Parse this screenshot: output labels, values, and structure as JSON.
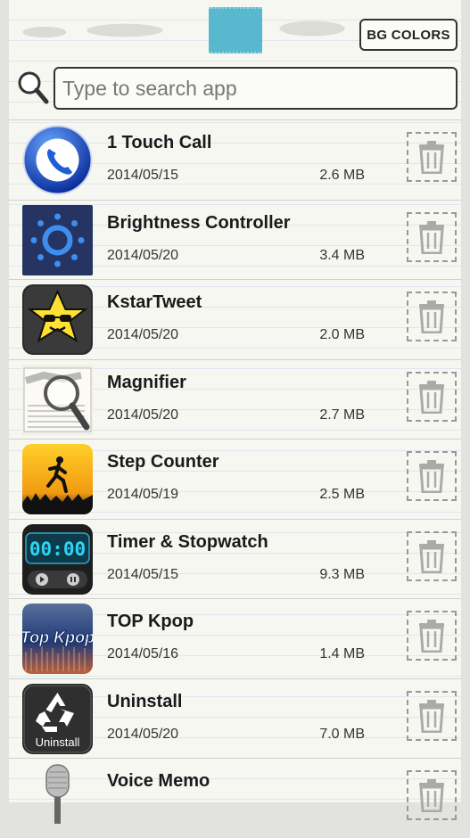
{
  "header": {
    "bg_colors_label": "BG COLORS"
  },
  "search": {
    "placeholder": "Type to search app"
  },
  "apps": [
    {
      "name": "1 Touch Call",
      "date": "2014/05/15",
      "size": "2.6 MB",
      "icon": "phone-icon"
    },
    {
      "name": "Brightness Controller",
      "date": "2014/05/20",
      "size": "3.4 MB",
      "icon": "brightness-icon"
    },
    {
      "name": "KstarTweet",
      "date": "2014/05/20",
      "size": "2.0 MB",
      "icon": "star-sunglasses-icon"
    },
    {
      "name": "Magnifier",
      "date": "2014/05/20",
      "size": "2.7 MB",
      "icon": "magnifier-news-icon"
    },
    {
      "name": "Step Counter",
      "date": "2014/05/19",
      "size": "2.5 MB",
      "icon": "runner-icon"
    },
    {
      "name": "Timer & Stopwatch",
      "date": "2014/05/15",
      "size": "9.3 MB",
      "icon": "timer-icon",
      "icon_text": "00:00"
    },
    {
      "name": "TOP Kpop",
      "date": "2014/05/16",
      "size": "1.4 MB",
      "icon": "top-kpop-icon",
      "icon_text": "Top Kpop"
    },
    {
      "name": "Uninstall",
      "date": "2014/05/20",
      "size": "7.0 MB",
      "icon": "recycle-icon",
      "icon_text": "Uninstall"
    },
    {
      "name": "Voice Memo",
      "date": "",
      "size": "",
      "icon": "microphone-icon"
    }
  ],
  "colors": {
    "tape": "#3eaec8",
    "paper": "#f7f7f1"
  }
}
